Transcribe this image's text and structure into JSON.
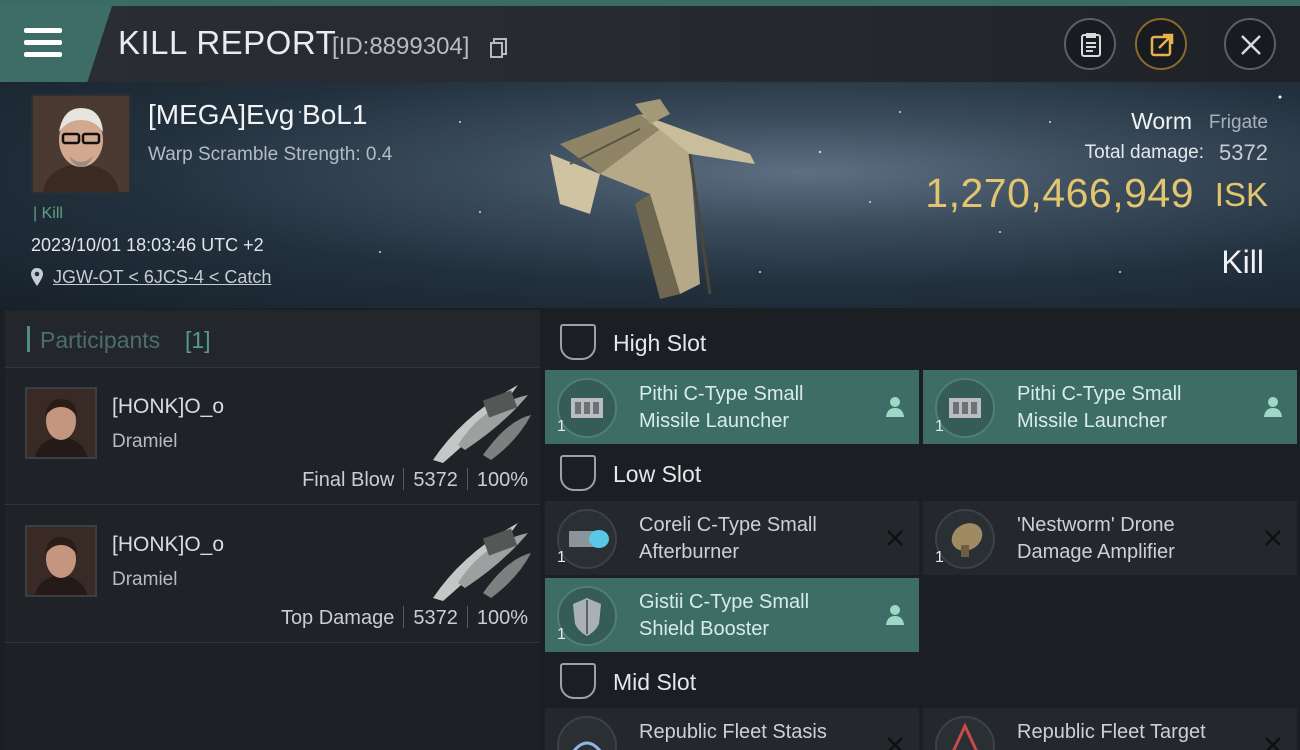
{
  "header": {
    "title": "KILL REPORT",
    "report_id": "[ID:8899304]"
  },
  "victim": {
    "name": "[MEGA]Evg BoL1",
    "warp_scramble": "Warp Scramble Strength: 0.4",
    "kill_tag": "Kill",
    "datetime": "2023/10/01 18:03:46 UTC +2",
    "location": "JGW-OT < 6JCS-4 < Catch",
    "ship_name": "Worm",
    "ship_class": "Frigate",
    "total_damage_label": "Total damage:",
    "total_damage": "5372",
    "isk_value": "1,270,466,949",
    "isk_unit": "ISK",
    "result": "Kill"
  },
  "participants": {
    "title": "Participants",
    "count": "[1]",
    "items": [
      {
        "name": "[HONK]O_o",
        "ship": "Dramiel",
        "role": "Final Blow",
        "damage": "5372",
        "percent": "100%"
      },
      {
        "name": "[HONK]O_o",
        "ship": "Dramiel",
        "role": "Top Damage",
        "damage": "5372",
        "percent": "100%"
      }
    ]
  },
  "slots": {
    "high": {
      "label": "High Slot",
      "modules": [
        {
          "line1": "Pithi C-Type Small",
          "line2": "Missile Launcher",
          "qty": "1",
          "state": "fitted"
        },
        {
          "line1": "Pithi C-Type Small",
          "line2": "Missile Launcher",
          "qty": "1",
          "state": "fitted"
        }
      ]
    },
    "low": {
      "label": "Low Slot",
      "modules": [
        {
          "line1": "Coreli C-Type Small",
          "line2": "Afterburner",
          "qty": "1",
          "state": "destroyed"
        },
        {
          "line1": "'Nestworm' Drone",
          "line2": "Damage Amplifier",
          "qty": "1",
          "state": "destroyed"
        },
        {
          "line1": "Gistii C-Type Small",
          "line2": "Shield Booster",
          "qty": "1",
          "state": "fitted"
        }
      ]
    },
    "mid": {
      "label": "Mid Slot",
      "modules": [
        {
          "line1": "Republic Fleet Stasis",
          "qty": "1",
          "state": "destroyed"
        },
        {
          "line1": "Republic Fleet Target",
          "qty": "1",
          "state": "destroyed"
        }
      ]
    }
  },
  "icons": {
    "menu": "hamburger-icon",
    "copy": "copy-icon",
    "clipboard": "clipboard-icon",
    "share": "share-icon",
    "close": "close-icon",
    "location": "location-pin-icon",
    "slot": "slot-shield-icon",
    "pilot": "pilot-icon",
    "destroyed": "cross-icon"
  },
  "colors": {
    "accent": "#3e6d65",
    "isk": "#e2c56e",
    "kill_tag": "#5ea083"
  }
}
